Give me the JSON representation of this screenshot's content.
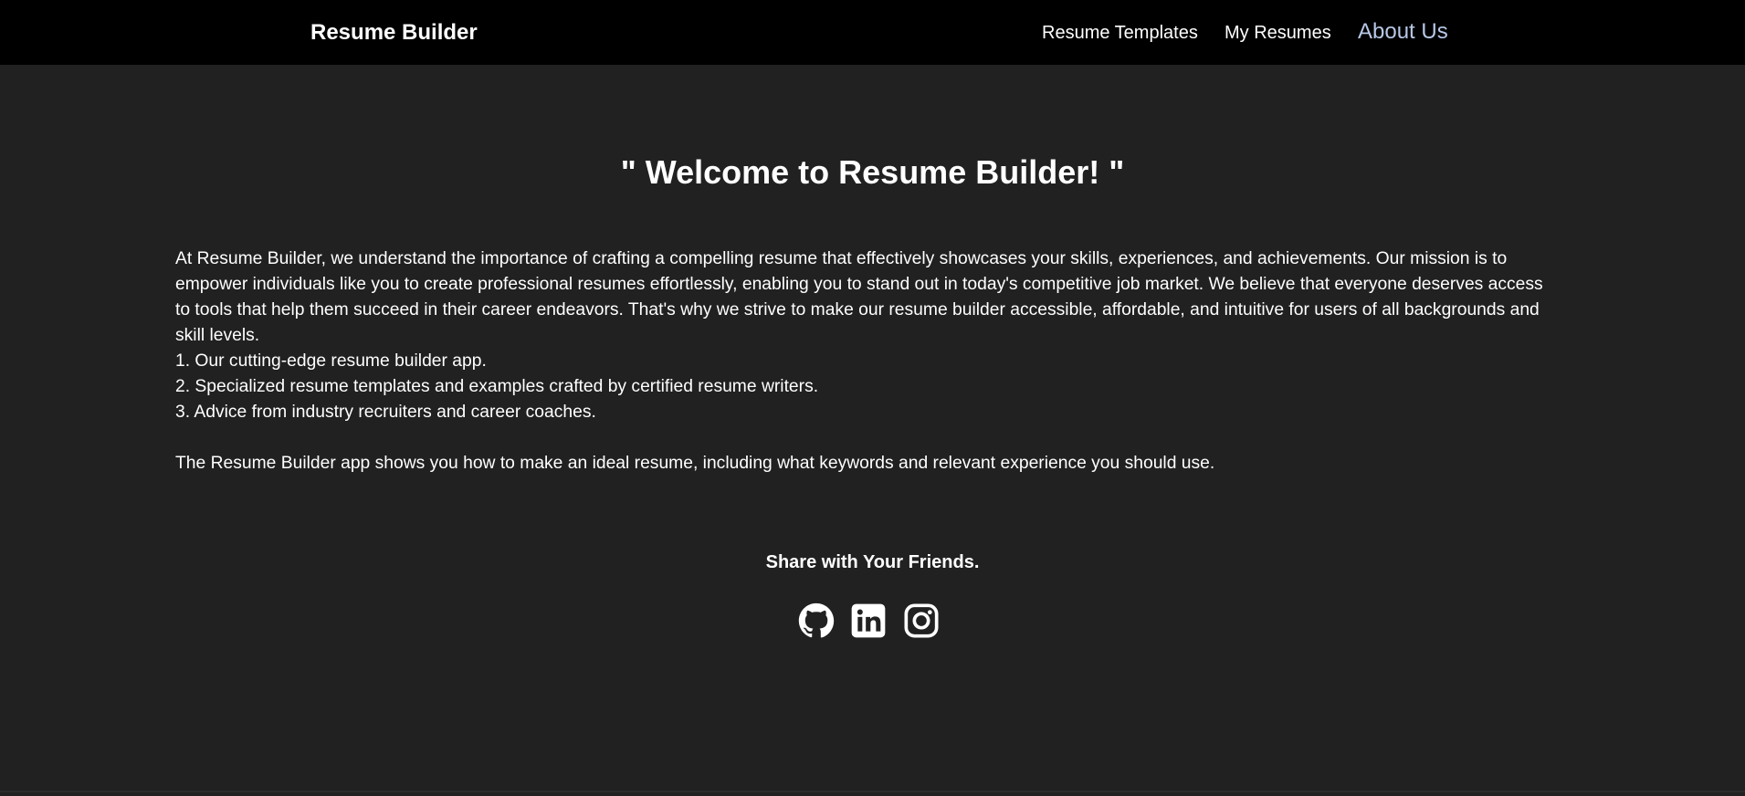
{
  "navbar": {
    "brand": "Resume Builder",
    "links": [
      "Resume Templates",
      "My Resumes",
      "About Us"
    ],
    "active_color": "#b7c8e6"
  },
  "main": {
    "title": "\" Welcome to Resume Builder! \"",
    "paragraphs": [
      "At Resume Builder, we understand the importance of crafting a compelling resume that effectively showcases your skills, experiences, and achievements. Our mission is to empower individuals like you to create professional resumes effortlessly, enabling you to stand out in today's competitive job market. We believe that everyone deserves access to tools that help them succeed in their career endeavors. That's why we strive to make our resume builder accessible, affordable, and intuitive for users of all backgrounds and skill levels.",
      "1. Our cutting-edge resume builder app.",
      "2. Specialized resume templates and examples crafted by certified resume writers.",
      "3. Advice from industry recruiters and career coaches.",
      "The Resume Builder app shows you how to make an ideal resume, including what keywords and relevant experience you should use."
    ]
  },
  "share": {
    "title": "Share with Your Friends.",
    "icons": [
      "github-icon",
      "linkedin-icon",
      "instagram-icon"
    ]
  },
  "colors": {
    "navbar_bg": "#000000",
    "page_bg": "#212121",
    "text": "#ffffff"
  }
}
